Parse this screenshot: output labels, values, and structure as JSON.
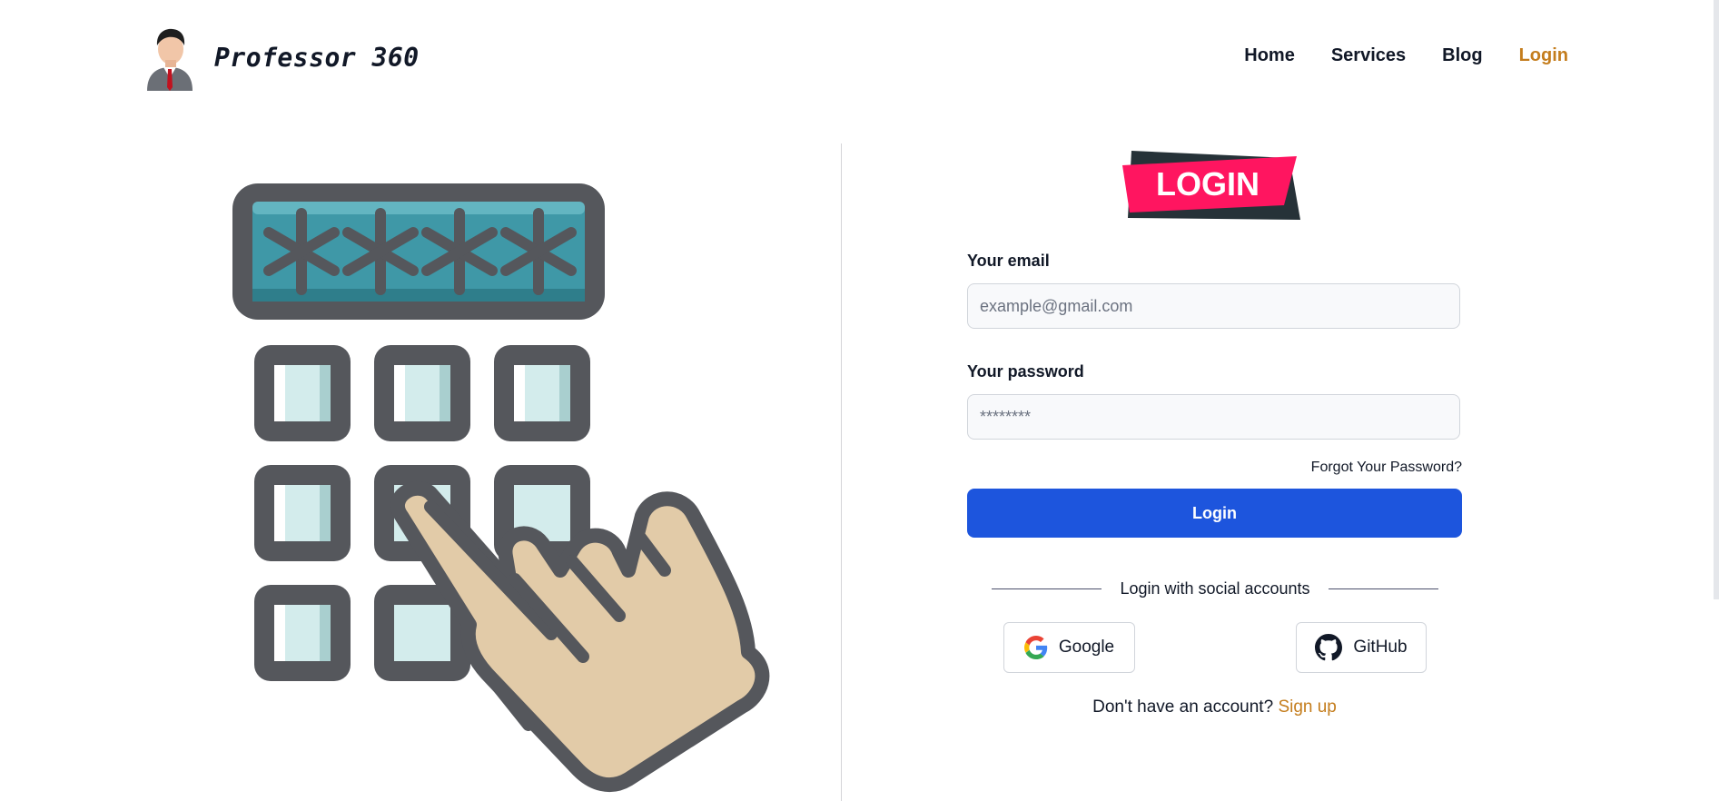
{
  "brand": {
    "name": "Professor 360",
    "avatar_icon": "professor-avatar-icon"
  },
  "nav": {
    "home": "Home",
    "services": "Services",
    "blog": "Blog",
    "login": "Login",
    "active_color": "#c47d1d"
  },
  "illustration": {
    "password_mask": "****",
    "icon": "keypad-password-hand-icon"
  },
  "badge": {
    "text": "LOGIN",
    "color": "#ff1560"
  },
  "form": {
    "email_label": "Your email",
    "email_placeholder": "example@gmail.com",
    "password_label": "Your password",
    "password_placeholder": "********",
    "forgot": "Forgot Your Password?",
    "login_button": "Login",
    "login_button_color": "#1d55dd"
  },
  "social": {
    "divider_text": "Login with social accounts",
    "google": "Google",
    "github": "GitHub"
  },
  "signup": {
    "prompt": "Don't have an account?",
    "link": "Sign up"
  }
}
